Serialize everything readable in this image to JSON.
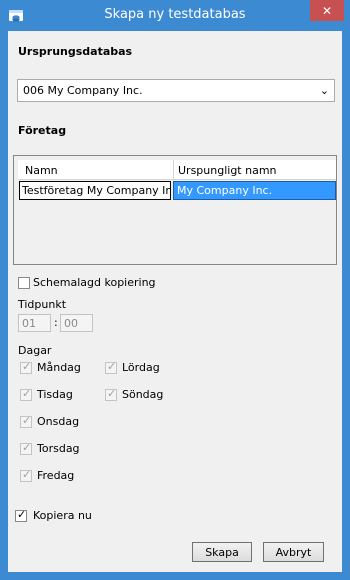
{
  "window": {
    "title": "Skapa ny testdatabas",
    "app_icon": "database-window-icon",
    "close_glyph": "✕",
    "accent_color": "#3c8ad2",
    "close_color": "#c75050"
  },
  "source_db": {
    "label": "Ursprungsdatabas",
    "selected": "006 My Company Inc.",
    "arrow": "⌄"
  },
  "company": {
    "label": "Företag",
    "columns": [
      "Namn",
      "Urspungligt namn"
    ],
    "rows": [
      {
        "name": "Testföretag My Company Inc.",
        "original": "My Company Inc."
      }
    ],
    "selection_color": "#3399ff"
  },
  "schedule": {
    "checkbox_label": "Schemalagd kopiering",
    "checked": false,
    "time_label": "Tidpunkt",
    "hour": "01",
    "minute": "00",
    "separator": ":",
    "days_label": "Dagar",
    "days": [
      {
        "label": "Måndag",
        "checked": true
      },
      {
        "label": "Tisdag",
        "checked": true
      },
      {
        "label": "Onsdag",
        "checked": true
      },
      {
        "label": "Torsdag",
        "checked": true
      },
      {
        "label": "Fredag",
        "checked": true
      },
      {
        "label": "Lördag",
        "checked": true
      },
      {
        "label": "Söndag",
        "checked": true
      }
    ]
  },
  "copy_now": {
    "label": "Kopiera nu",
    "checked": true
  },
  "buttons": {
    "create": "Skapa",
    "cancel": "Avbryt"
  },
  "check_glyph": "✓"
}
